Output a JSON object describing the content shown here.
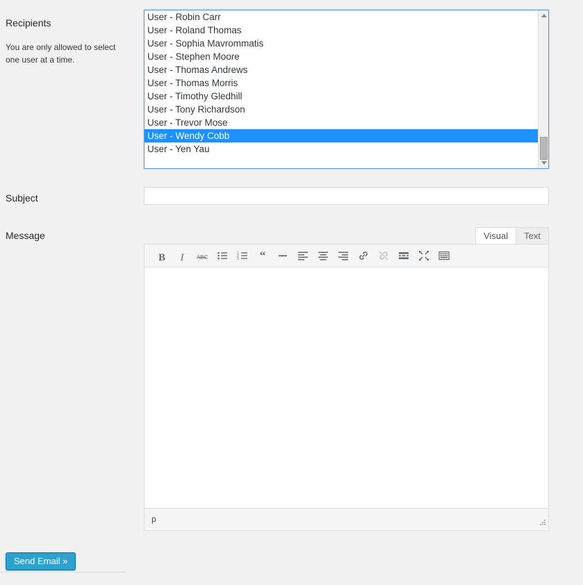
{
  "form": {
    "recipients": {
      "label": "Recipients",
      "help": "You are only allowed to select one user at a time.",
      "options": [
        "User - Robin Carr",
        "User - Roland Thomas",
        "User - Sophia Mavrommatis",
        "User - Stephen Moore",
        "User - Thomas Andrews",
        "User - Thomas Morris",
        "User - Timothy Gledhill",
        "User - Tony Richardson",
        "User - Trevor Mose",
        "User - Wendy Cobb",
        "User - Yen Yau"
      ],
      "selected": "User - Wendy Cobb",
      "selected_index": 9,
      "highlight_color": "#1e90ff",
      "focus_border_color": "#5b9dd9"
    },
    "subject": {
      "label": "Subject",
      "value": "",
      "placeholder": ""
    },
    "message": {
      "label": "Message",
      "tabs": [
        {
          "label": "Visual",
          "active": true
        },
        {
          "label": "Text",
          "active": false
        }
      ],
      "toolbar": [
        {
          "name": "bold",
          "title": "Bold",
          "disabled": false
        },
        {
          "name": "italic",
          "title": "Italic",
          "disabled": false
        },
        {
          "name": "strikethrough",
          "title": "ABC",
          "disabled": false
        },
        {
          "name": "bulleted-list",
          "title": "Bulleted list",
          "disabled": false
        },
        {
          "name": "numbered-list",
          "title": "Numbered list",
          "disabled": false
        },
        {
          "name": "blockquote",
          "title": "Blockquote",
          "disabled": false
        },
        {
          "name": "horizontal-rule",
          "title": "Horizontal line",
          "disabled": false
        },
        {
          "name": "align-left",
          "title": "Align left",
          "disabled": false
        },
        {
          "name": "align-center",
          "title": "Align center",
          "disabled": false
        },
        {
          "name": "align-right",
          "title": "Align right",
          "disabled": false
        },
        {
          "name": "insert-link",
          "title": "Insert/edit link",
          "disabled": false
        },
        {
          "name": "remove-link",
          "title": "Remove link",
          "disabled": true
        },
        {
          "name": "insert-read-more",
          "title": "Insert Read More tag",
          "disabled": false
        },
        {
          "name": "distraction-free",
          "title": "Distraction-free writing mode",
          "disabled": false
        },
        {
          "name": "toolbar-toggle",
          "title": "Toolbar Toggle",
          "disabled": false
        }
      ],
      "body": "",
      "status_path": "p"
    }
  },
  "footer": {
    "submit_label": "Send Email »",
    "submit_color": "#2ea2cc"
  }
}
